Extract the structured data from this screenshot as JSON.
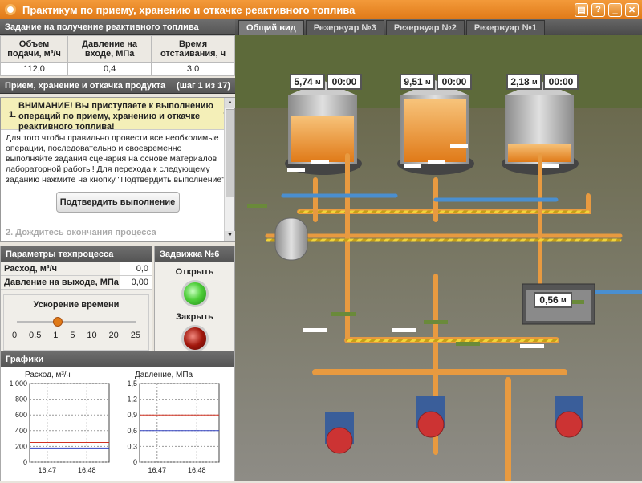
{
  "window": {
    "title": "Практикум по приему, хранению и откачке реактивного топлива"
  },
  "task": {
    "header": "Задание на получение реактивного топлива",
    "columns": [
      "Объем подачи, м³/ч",
      "Давление на входе, МПа",
      "Время отстаивания, ч"
    ],
    "values": [
      "112,0",
      "0,4",
      "3,0"
    ]
  },
  "steps": {
    "header": "Прием, хранение и откачка продукта",
    "counter": "(шаг 1 из 17)",
    "step1_num": "1.",
    "step1_text": "ВНИМАНИЕ! Вы приступаете к выполнению операций по приему, хранению и откачке реактивного топлива!",
    "instruction": "Для того чтобы правильно провести все необходимые операции, последовательно и своевременно выполняйте задания сценария на основе материалов лабораторной работы! Для перехода к следующему заданию нажмите на кнопку \"Подтвердить выполнение\".",
    "confirm_label": "Подтвердить выполнение",
    "step2_num": "2.",
    "step2_text": "Дождитесь окончания процесса"
  },
  "params": {
    "header": "Параметры техпроцесса",
    "flow_label": "Расход, м³/ч",
    "flow_value": "0,0",
    "pressure_label": "Давление на выходе, МПа",
    "pressure_value": "0,00",
    "speed_label": "Ускорение времени",
    "speed_ticks": [
      "0",
      "0.5",
      "1",
      "5",
      "10",
      "20",
      "25"
    ],
    "speed_selected": "1"
  },
  "valve": {
    "header": "Задвижка №6",
    "open_label": "Открыть",
    "close_label": "Закрыть"
  },
  "charts": {
    "header": "Графики"
  },
  "chart_data": [
    {
      "type": "line",
      "title": "Расход, м³/ч",
      "x": [
        "16:47",
        "16:48"
      ],
      "ylim": [
        0,
        1000
      ],
      "yticks": [
        "0",
        "200",
        "400",
        "600",
        "800",
        "1 000"
      ],
      "series": [
        {
          "color": "#d03020",
          "values": [
            250,
            250
          ]
        },
        {
          "color": "#3040c0",
          "values": [
            180,
            180
          ]
        }
      ]
    },
    {
      "type": "line",
      "title": "Давление, МПа",
      "x": [
        "16:47",
        "16:48"
      ],
      "ylim": [
        0,
        1.5
      ],
      "yticks": [
        "0",
        "0,3",
        "0,6",
        "0,9",
        "1,2",
        "1,5"
      ],
      "series": [
        {
          "color": "#d03020",
          "values": [
            0.9,
            0.9
          ]
        },
        {
          "color": "#3040c0",
          "values": [
            0.6,
            0.6
          ]
        }
      ]
    }
  ],
  "tabs": [
    "Общий вид",
    "Резервуар №3",
    "Резервуар №2",
    "Резервуар №1"
  ],
  "scene": {
    "tank3_level": "5,74",
    "tank3_time": "00:00",
    "tank2_level": "9,51",
    "tank2_time": "00:00",
    "tank1_level": "2,18",
    "tank1_time": "00:00",
    "sump_level": "0,56",
    "unit": "м"
  },
  "colors": {
    "accent": "#e07a18",
    "fuel": "#f0a030",
    "pipe_orange": "#e89a40",
    "pipe_blue": "#4a8fd0"
  }
}
